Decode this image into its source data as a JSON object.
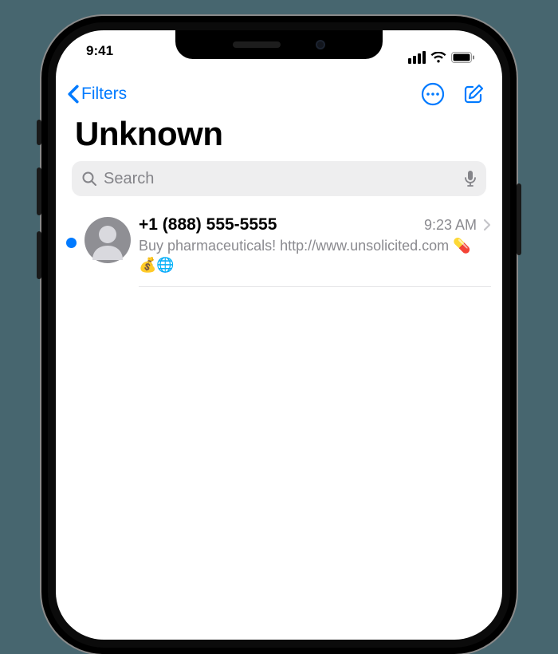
{
  "status": {
    "time": "9:41"
  },
  "nav": {
    "back_label": "Filters"
  },
  "header": {
    "title": "Unknown"
  },
  "search": {
    "placeholder": "Search"
  },
  "conversations": [
    {
      "sender": "+1 (888) 555-5555",
      "time": "9:23 AM",
      "preview": "Buy pharmaceuticals! http://www.unsolicited.com 💊💰🌐",
      "unread": true
    }
  ]
}
